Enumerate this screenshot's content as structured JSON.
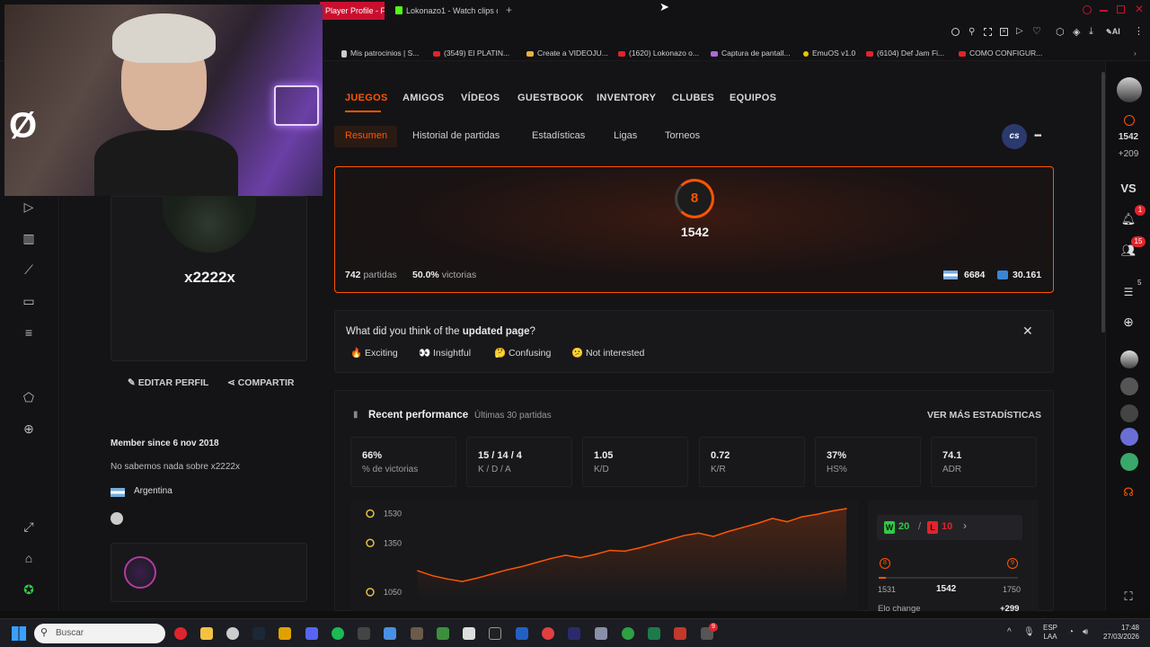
{
  "browser": {
    "tabs": [
      {
        "label": "Player Profile - F"
      },
      {
        "label": "Lokonazo1 - Watch clips o"
      }
    ],
    "new_tab": "+",
    "toolbar_ai": "AI",
    "bookmarks": [
      "Mis patrocinios | S...",
      "(3549) El PLATIN...",
      "Create a VIDEOJU...",
      "(1620) Lokonazo o...",
      "Captura de pantall...",
      "EmuOS v1.0",
      "(6104) Def Jam Fi...",
      "COMO CONFIGUR..."
    ]
  },
  "profile": {
    "username": "x2222x",
    "edit_label": "EDITAR PERFIL",
    "share_label": "COMPARTIR",
    "member_since": "Member since 6 nov 2018",
    "bio": "No sabemos nada sobre x2222x",
    "country": "Argentina"
  },
  "nav": {
    "tabs": [
      "JUEGOS",
      "AMIGOS",
      "VÍDEOS",
      "GUESTBOOK",
      "INVENTORY",
      "CLUBES",
      "EQUIPOS"
    ],
    "subtabs": [
      "Resumen",
      "Historial de partidas",
      "Estadísticas",
      "Ligas",
      "Torneos"
    ],
    "game_badge": "cs",
    "more": "•••"
  },
  "elo_card": {
    "level": "8",
    "elo": "1542",
    "matches": "742",
    "matches_label": "partidas",
    "winrate": "50.0%",
    "winrate_label": "victorias",
    "country_rank": "6684",
    "region_rank": "30.161"
  },
  "feedback": {
    "question_prefix": "What did you think of the ",
    "question_bold": "updated page",
    "question_suffix": "?",
    "options": [
      {
        "emoji": "🔥",
        "label": "Exciting"
      },
      {
        "emoji": "👀",
        "label": "Insightful"
      },
      {
        "emoji": "🤔",
        "label": "Confusing"
      },
      {
        "emoji": "😕",
        "label": "Not interested"
      }
    ],
    "close": "✕"
  },
  "performance": {
    "title": "Recent performance",
    "subtitle": "Últimas 30 partidas",
    "more_stats": "VER MÁS ESTADÍSTICAS",
    "stats": [
      {
        "value": "66%",
        "label": "% de victorias"
      },
      {
        "value": "15 / 14 / 4",
        "label": "K / D / A"
      },
      {
        "value": "1.05",
        "label": "K/D"
      },
      {
        "value": "0.72",
        "label": "K/R"
      },
      {
        "value": "37%",
        "label": "HS%"
      },
      {
        "value": "74.1",
        "label": "ADR"
      }
    ],
    "wins": "20",
    "losses": "10",
    "win_badge": "W",
    "loss_badge": "L",
    "sep": "/",
    "range_low": "1531",
    "range_current": "1542",
    "range_high": "1750",
    "elo_change_label": "Elo change",
    "elo_change_value": "+299"
  },
  "chart_data": {
    "type": "line",
    "y_ticks": [
      "1530",
      "1350",
      "1050"
    ],
    "ylim": [
      1000,
      1560
    ],
    "values": [
      1180,
      1150,
      1130,
      1115,
      1135,
      1160,
      1185,
      1205,
      1230,
      1255,
      1275,
      1260,
      1280,
      1305,
      1300,
      1320,
      1345,
      1370,
      1395,
      1410,
      1390,
      1420,
      1445,
      1470,
      1500,
      1480,
      1510,
      1525,
      1545,
      1560
    ],
    "color": "#ff5500"
  },
  "rightrail": {
    "elo": "1542",
    "elo_change": "+209",
    "vs": "VS",
    "notif_count": "1",
    "friends_count": "15",
    "party_count": "5"
  },
  "taskbar": {
    "search_placeholder": "Buscar",
    "lang": "ESP",
    "lang2": "LAA",
    "time": "17:48",
    "date": "27/03/2026",
    "badge": "9"
  },
  "colors": {
    "accent": "#ff5500",
    "win": "#2ecc40",
    "loss": "#e0242b"
  }
}
